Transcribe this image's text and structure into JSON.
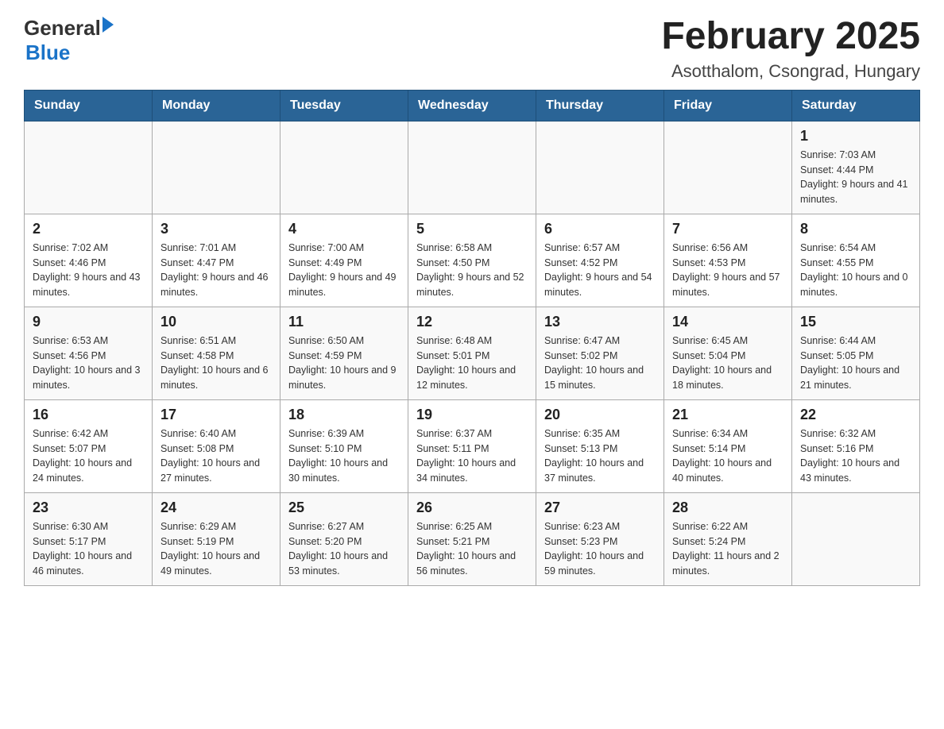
{
  "logo": {
    "general": "General",
    "blue": "Blue",
    "arrow": true
  },
  "title": "February 2025",
  "subtitle": "Asotthalom, Csongrad, Hungary",
  "weekdays": [
    "Sunday",
    "Monday",
    "Tuesday",
    "Wednesday",
    "Thursday",
    "Friday",
    "Saturday"
  ],
  "weeks": [
    [
      {
        "day": "",
        "info": ""
      },
      {
        "day": "",
        "info": ""
      },
      {
        "day": "",
        "info": ""
      },
      {
        "day": "",
        "info": ""
      },
      {
        "day": "",
        "info": ""
      },
      {
        "day": "",
        "info": ""
      },
      {
        "day": "1",
        "info": "Sunrise: 7:03 AM\nSunset: 4:44 PM\nDaylight: 9 hours and 41 minutes."
      }
    ],
    [
      {
        "day": "2",
        "info": "Sunrise: 7:02 AM\nSunset: 4:46 PM\nDaylight: 9 hours and 43 minutes."
      },
      {
        "day": "3",
        "info": "Sunrise: 7:01 AM\nSunset: 4:47 PM\nDaylight: 9 hours and 46 minutes."
      },
      {
        "day": "4",
        "info": "Sunrise: 7:00 AM\nSunset: 4:49 PM\nDaylight: 9 hours and 49 minutes."
      },
      {
        "day": "5",
        "info": "Sunrise: 6:58 AM\nSunset: 4:50 PM\nDaylight: 9 hours and 52 minutes."
      },
      {
        "day": "6",
        "info": "Sunrise: 6:57 AM\nSunset: 4:52 PM\nDaylight: 9 hours and 54 minutes."
      },
      {
        "day": "7",
        "info": "Sunrise: 6:56 AM\nSunset: 4:53 PM\nDaylight: 9 hours and 57 minutes."
      },
      {
        "day": "8",
        "info": "Sunrise: 6:54 AM\nSunset: 4:55 PM\nDaylight: 10 hours and 0 minutes."
      }
    ],
    [
      {
        "day": "9",
        "info": "Sunrise: 6:53 AM\nSunset: 4:56 PM\nDaylight: 10 hours and 3 minutes."
      },
      {
        "day": "10",
        "info": "Sunrise: 6:51 AM\nSunset: 4:58 PM\nDaylight: 10 hours and 6 minutes."
      },
      {
        "day": "11",
        "info": "Sunrise: 6:50 AM\nSunset: 4:59 PM\nDaylight: 10 hours and 9 minutes."
      },
      {
        "day": "12",
        "info": "Sunrise: 6:48 AM\nSunset: 5:01 PM\nDaylight: 10 hours and 12 minutes."
      },
      {
        "day": "13",
        "info": "Sunrise: 6:47 AM\nSunset: 5:02 PM\nDaylight: 10 hours and 15 minutes."
      },
      {
        "day": "14",
        "info": "Sunrise: 6:45 AM\nSunset: 5:04 PM\nDaylight: 10 hours and 18 minutes."
      },
      {
        "day": "15",
        "info": "Sunrise: 6:44 AM\nSunset: 5:05 PM\nDaylight: 10 hours and 21 minutes."
      }
    ],
    [
      {
        "day": "16",
        "info": "Sunrise: 6:42 AM\nSunset: 5:07 PM\nDaylight: 10 hours and 24 minutes."
      },
      {
        "day": "17",
        "info": "Sunrise: 6:40 AM\nSunset: 5:08 PM\nDaylight: 10 hours and 27 minutes."
      },
      {
        "day": "18",
        "info": "Sunrise: 6:39 AM\nSunset: 5:10 PM\nDaylight: 10 hours and 30 minutes."
      },
      {
        "day": "19",
        "info": "Sunrise: 6:37 AM\nSunset: 5:11 PM\nDaylight: 10 hours and 34 minutes."
      },
      {
        "day": "20",
        "info": "Sunrise: 6:35 AM\nSunset: 5:13 PM\nDaylight: 10 hours and 37 minutes."
      },
      {
        "day": "21",
        "info": "Sunrise: 6:34 AM\nSunset: 5:14 PM\nDaylight: 10 hours and 40 minutes."
      },
      {
        "day": "22",
        "info": "Sunrise: 6:32 AM\nSunset: 5:16 PM\nDaylight: 10 hours and 43 minutes."
      }
    ],
    [
      {
        "day": "23",
        "info": "Sunrise: 6:30 AM\nSunset: 5:17 PM\nDaylight: 10 hours and 46 minutes."
      },
      {
        "day": "24",
        "info": "Sunrise: 6:29 AM\nSunset: 5:19 PM\nDaylight: 10 hours and 49 minutes."
      },
      {
        "day": "25",
        "info": "Sunrise: 6:27 AM\nSunset: 5:20 PM\nDaylight: 10 hours and 53 minutes."
      },
      {
        "day": "26",
        "info": "Sunrise: 6:25 AM\nSunset: 5:21 PM\nDaylight: 10 hours and 56 minutes."
      },
      {
        "day": "27",
        "info": "Sunrise: 6:23 AM\nSunset: 5:23 PM\nDaylight: 10 hours and 59 minutes."
      },
      {
        "day": "28",
        "info": "Sunrise: 6:22 AM\nSunset: 5:24 PM\nDaylight: 11 hours and 2 minutes."
      },
      {
        "day": "",
        "info": ""
      }
    ]
  ]
}
